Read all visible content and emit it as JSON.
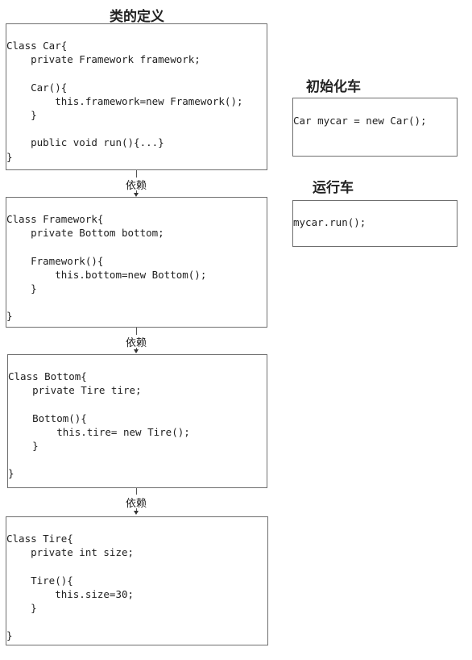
{
  "titles": {
    "class_def": "类的定义",
    "init_car": "初始化车",
    "run_car": "运行车"
  },
  "dependency_label": "依赖",
  "code_blocks": {
    "car": [
      "Class Car{",
      "    private Framework framework;",
      "",
      "    Car(){",
      "        this.framework=new Framework();",
      "    }",
      "",
      "    public void run(){...}",
      "}"
    ],
    "framework": [
      "Class Framework{",
      "    private Bottom bottom;",
      "",
      "    Framework(){",
      "        this.bottom=new Bottom();",
      "    }",
      "",
      "}"
    ],
    "bottom": [
      "Class Bottom{",
      "    private Tire tire;",
      "",
      "    Bottom(){",
      "        this.tire= new Tire();",
      "    }",
      "",
      "}"
    ],
    "tire": [
      "Class Tire{",
      "    private int size;",
      "",
      "    Tire(){",
      "        this.size=30;",
      "    }",
      "",
      "}"
    ],
    "init": [
      "Car mycar = new Car();"
    ],
    "run": [
      "mycar.run();"
    ]
  }
}
